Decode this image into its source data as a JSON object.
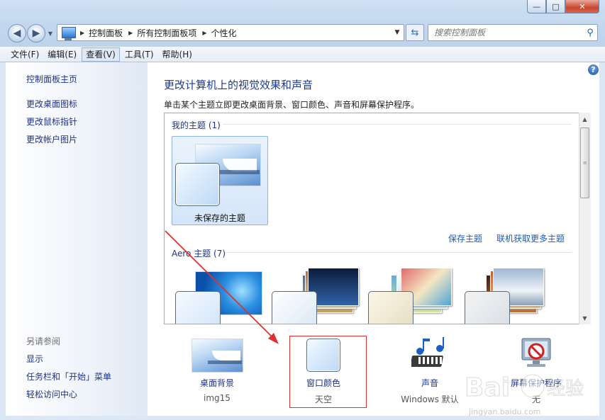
{
  "window": {
    "controls": {
      "minimize": "—",
      "maximize": "□",
      "close": "✕"
    }
  },
  "address": {
    "crumbs": [
      "控制面板",
      "所有控制面板项",
      "个性化"
    ],
    "search_placeholder": "搜索控制面板"
  },
  "menubar": {
    "items": [
      "文件(F)",
      "编辑(E)",
      "查看(V)",
      "工具(T)",
      "帮助(H)"
    ],
    "active": "查看(V)"
  },
  "sidebar": {
    "home": "控制面板主页",
    "links": [
      "更改桌面图标",
      "更改鼠标指针",
      "更改帐户图片"
    ],
    "see_also_title": "另请参阅",
    "see_also": [
      "显示",
      "任务栏和「开始」菜单",
      "轻松访问中心"
    ]
  },
  "main": {
    "title": "更改计算机上的视觉效果和声音",
    "description": "单击某个主题立即更改桌面背景、窗口颜色、声音和屏幕保护程序。",
    "my_themes_header": "我的主题 (1)",
    "unsaved_theme": "未保存的主题",
    "save_theme": "保存主题",
    "more_themes": "联机获取更多主题",
    "aero_header": "Aero 主题 (7)"
  },
  "bottom": [
    {
      "label": "桌面背景",
      "value": "img15"
    },
    {
      "label": "窗口颜色",
      "value": "天空"
    },
    {
      "label": "声音",
      "value": "Windows 默认"
    },
    {
      "label": "屏幕保护程序",
      "value": "无"
    }
  ],
  "colors": {
    "link": "#1e3287",
    "title": "#1e3a8a",
    "annotation": "#e03030",
    "window_chrome": "#c3d8ef"
  },
  "icons": [
    "back-arrow-icon",
    "forward-arrow-icon",
    "control-panel-icon",
    "refresh-icon",
    "search-icon",
    "help-icon",
    "music-notes-icon",
    "screensaver-icon"
  ],
  "watermark": "Baidu经验",
  "watermark_url": "jingyan.baidu.com"
}
